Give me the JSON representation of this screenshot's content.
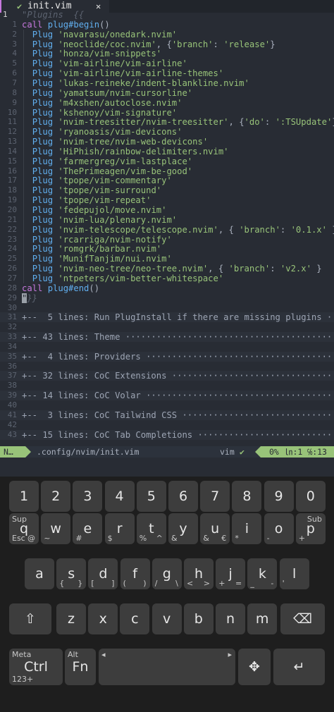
{
  "tabline": {
    "check": "✔",
    "title": "init.vim",
    "close": "✕"
  },
  "editor": {
    "lines": [
      {
        "n": "1",
        "type": "comment",
        "text": "\"Plugins  {{"
      },
      {
        "n": "1",
        "type": "call_begin",
        "parts": [
          [
            "kw",
            "call "
          ],
          [
            "fn",
            "plug#begin"
          ],
          [
            "",
            "()"
          ]
        ]
      },
      {
        "n": "2",
        "type": "plug",
        "arg": "'navarasu/onedark.nvim'",
        "extra": ""
      },
      {
        "n": "3",
        "type": "plug",
        "arg": "'neoclide/coc.nvim'",
        "extra": ", {'branch': 'release'}"
      },
      {
        "n": "4",
        "type": "plug",
        "arg": "'honza/vim-snippets'",
        "extra": ""
      },
      {
        "n": "5",
        "type": "plug",
        "arg": "'vim-airline/vim-airline'",
        "extra": ""
      },
      {
        "n": "6",
        "type": "plug",
        "arg": "'vim-airline/vim-airline-themes'",
        "extra": ""
      },
      {
        "n": "7",
        "type": "plug",
        "arg": "'lukas-reineke/indent-blankline.nvim'",
        "extra": ""
      },
      {
        "n": "8",
        "type": "plug",
        "arg": "'yamatsum/nvim-cursorline'",
        "extra": ""
      },
      {
        "n": "9",
        "type": "plug",
        "arg": "'m4xshen/autoclose.nvim'",
        "extra": ""
      },
      {
        "n": "10",
        "type": "plug",
        "arg": "'kshenoy/vim-signature'",
        "extra": ""
      },
      {
        "n": "11",
        "type": "plug",
        "arg": "'nvim-treesitter/nvim-treesitter'",
        "extra": ", {'do': ':TSUpdate'}"
      },
      {
        "n": "12",
        "type": "plug",
        "arg": "'ryanoasis/vim-devicons'",
        "extra": ""
      },
      {
        "n": "13",
        "type": "plug",
        "arg": "'nvim-tree/nvim-web-devicons'",
        "extra": ""
      },
      {
        "n": "14",
        "type": "plug",
        "arg": "'HiPhish/rainbow-delimiters.nvim'",
        "extra": ""
      },
      {
        "n": "15",
        "type": "plug",
        "arg": "'farmergreg/vim-lastplace'",
        "extra": ""
      },
      {
        "n": "16",
        "type": "plug",
        "arg": "'ThePrimeagen/vim-be-good'",
        "extra": ""
      },
      {
        "n": "17",
        "type": "plug",
        "arg": "'tpope/vim-commentary'",
        "extra": ""
      },
      {
        "n": "18",
        "type": "plug",
        "arg": "'tpope/vim-surround'",
        "extra": ""
      },
      {
        "n": "19",
        "type": "plug",
        "arg": "'tpope/vim-repeat'",
        "extra": ""
      },
      {
        "n": "20",
        "type": "plug",
        "arg": "'fedepujol/move.nvim'",
        "extra": ""
      },
      {
        "n": "21",
        "type": "plug",
        "arg": "'nvim-lua/plenary.nvim'",
        "extra": ""
      },
      {
        "n": "22",
        "type": "plug",
        "arg": "'nvim-telescope/telescope.nvim'",
        "extra": ", { 'branch': '0.1.x' }"
      },
      {
        "n": "23",
        "type": "plug",
        "arg": "'rcarriga/nvim-notify'",
        "extra": ""
      },
      {
        "n": "24",
        "type": "plug",
        "arg": "'romgrk/barbar.nvim'",
        "extra": ""
      },
      {
        "n": "25",
        "type": "plug",
        "arg": "'MunifTanjim/nui.nvim'",
        "extra": ""
      },
      {
        "n": "26",
        "type": "plug",
        "arg": "'nvim-neo-tree/neo-tree.nvim'",
        "extra": ", { 'branch': 'v2.x' }"
      },
      {
        "n": "27",
        "type": "plug",
        "arg": "'ntpeters/vim-better-whitespace'",
        "extra": ""
      },
      {
        "n": "28",
        "type": "call_end",
        "parts": [
          [
            "kw",
            "call "
          ],
          [
            "fn",
            "plug#end"
          ],
          [
            "",
            "()"
          ]
        ]
      },
      {
        "n": "29",
        "type": "closefold",
        "text": "}}"
      },
      {
        "n": "30",
        "type": "blank",
        "text": ""
      },
      {
        "n": "31",
        "type": "fold",
        "text": "+--  5 lines: Run PlugInstall if there are missing plugins ·····"
      },
      {
        "n": "32",
        "type": "blank",
        "text": ""
      },
      {
        "n": "33",
        "type": "fold",
        "text": "+-- 43 lines: Theme ·············································"
      },
      {
        "n": "34",
        "type": "blank",
        "text": ""
      },
      {
        "n": "35",
        "type": "fold",
        "text": "+--  4 lines: Providers ·········································"
      },
      {
        "n": "36",
        "type": "blank",
        "text": ""
      },
      {
        "n": "37",
        "type": "fold",
        "text": "+-- 32 lines: CoC Extensions ····································"
      },
      {
        "n": "38",
        "type": "blank",
        "text": ""
      },
      {
        "n": "39",
        "type": "fold",
        "text": "+-- 14 lines: CoC Volar ·········································"
      },
      {
        "n": "40",
        "type": "blank",
        "text": ""
      },
      {
        "n": "41",
        "type": "fold",
        "text": "+--  3 lines: CoC Tailwind CSS ··································"
      },
      {
        "n": "42",
        "type": "blank",
        "text": ""
      },
      {
        "n": "43",
        "type": "fold",
        "text": "+-- 15 lines: CoC Tab Completions ·······························"
      }
    ]
  },
  "statusline": {
    "mode": "N…",
    "filepath": ".config/nvim/init.vim",
    "filetype": "vim",
    "ft_check": "✔",
    "percent": "0%",
    "position": "㏑:1 ℅:13"
  },
  "colors": {
    "accent": "#98c379",
    "keyword": "#c678dd",
    "function": "#61afef",
    "string": "#98c379",
    "background": "#282c34"
  },
  "keyboard": {
    "rows": [
      [
        {
          "m": "1"
        },
        {
          "m": "2"
        },
        {
          "m": "3"
        },
        {
          "m": "4"
        },
        {
          "m": "5"
        },
        {
          "m": "6"
        },
        {
          "m": "7"
        },
        {
          "m": "8"
        },
        {
          "m": "9"
        },
        {
          "m": "0"
        }
      ],
      [
        {
          "m": "q",
          "tl": "Sup",
          "bl": "Esc",
          "br": "@"
        },
        {
          "m": "w",
          "bl": "~"
        },
        {
          "m": "e",
          "bl": "#"
        },
        {
          "m": "r",
          "bl": "$"
        },
        {
          "m": "t",
          "bl": "%",
          "br": "^"
        },
        {
          "m": "y",
          "bl": "&"
        },
        {
          "m": "u",
          "bl": "&",
          "br": "€"
        },
        {
          "m": "i",
          "bl": "*"
        },
        {
          "m": "o",
          "bl": "-"
        },
        {
          "m": "p",
          "tr": "Sub",
          "bl": "+"
        }
      ],
      [
        {
          "m": "a"
        },
        {
          "m": "s",
          "bl": "{",
          "br": "}"
        },
        {
          "m": "d",
          "bl": "[",
          "br": "]"
        },
        {
          "m": "f",
          "bl": "(",
          "br": ")"
        },
        {
          "m": "g",
          "bl": "/",
          "br": "\\"
        },
        {
          "m": "h",
          "bl": "<",
          "br": ">"
        },
        {
          "m": "j",
          "bl": "+",
          "br": "="
        },
        {
          "m": "k",
          "bl": "_",
          "br": "-"
        },
        {
          "m": "l",
          "bl": "'"
        }
      ],
      [
        {
          "m": "z"
        },
        {
          "m": "x"
        },
        {
          "m": "c"
        },
        {
          "m": "v"
        },
        {
          "m": "b"
        },
        {
          "m": "n"
        },
        {
          "m": "m"
        }
      ],
      [
        {
          "m": "Ctrl",
          "tl": "Meta",
          "bl": "123+"
        },
        {
          "m": "Fn",
          "tl": "Alt"
        }
      ]
    ]
  }
}
